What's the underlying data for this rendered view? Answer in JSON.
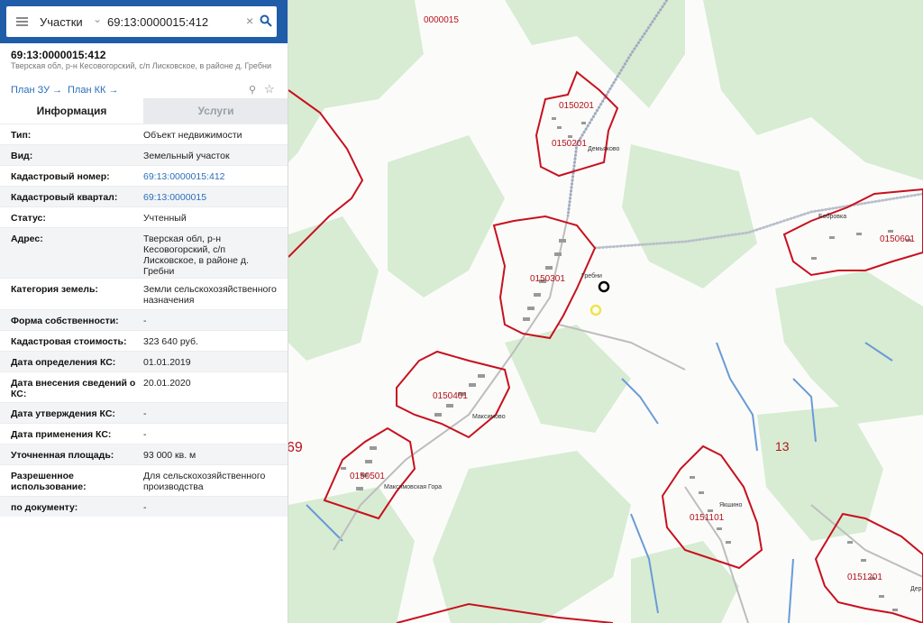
{
  "search": {
    "type_label": "Участки",
    "query": "69:13:0000015:412"
  },
  "object": {
    "title": "69:13:0000015:412",
    "address_short": "Тверская обл, р-н Кесовогорский, с/п Лисковское, в районе д. Гребни"
  },
  "links": {
    "plan_zu": "План ЗУ",
    "plan_kk": "План КК"
  },
  "tabs": {
    "info": "Информация",
    "services": "Услуги"
  },
  "info_rows": [
    {
      "label": "Тип:",
      "value": "Объект недвижимости"
    },
    {
      "label": "Вид:",
      "value": "Земельный участок"
    },
    {
      "label": "Кадастровый номер:",
      "value": "69:13:0000015:412",
      "link": true
    },
    {
      "label": "Кадастровый квартал:",
      "value": "69:13:0000015",
      "link": true
    },
    {
      "label": "Статус:",
      "value": "Учтенный"
    },
    {
      "label": "Адрес:",
      "value": "Тверская обл, р-н Кесовогорский, с/п Лисковское, в районе д. Гребни"
    },
    {
      "label": "Категория земель:",
      "value": "Земли сельскохозяйственного назначения"
    },
    {
      "label": "Форма собственности:",
      "value": "-"
    },
    {
      "label": "Кадастровая стоимость:",
      "value": "323 640 руб."
    },
    {
      "label": "Дата определения КС:",
      "value": "01.01.2019"
    },
    {
      "label": "Дата внесения сведений о КС:",
      "value": "20.01.2020"
    },
    {
      "label": "Дата утверждения КС:",
      "value": "-"
    },
    {
      "label": "Дата применения КС:",
      "value": "-"
    },
    {
      "label": "Уточненная площадь:",
      "value": "93 000 кв. м"
    },
    {
      "label": "Разрешенное использование:",
      "value": "Для сельскохозяйственного производства"
    },
    {
      "label": "по документу:",
      "value": "-"
    }
  ],
  "map": {
    "labels": [
      {
        "id": "q-0000015",
        "text": "0000015"
      },
      {
        "id": "q-0150201a",
        "text": "0150201"
      },
      {
        "id": "q-0150201b",
        "text": "0150201"
      },
      {
        "id": "q-0150301",
        "text": "0150301"
      },
      {
        "id": "q-0150401",
        "text": "0150401"
      },
      {
        "id": "q-0150501",
        "text": "0150501"
      },
      {
        "id": "q-0150601",
        "text": "0150601"
      },
      {
        "id": "q-0151101",
        "text": "0151101"
      },
      {
        "id": "q-0151201",
        "text": "0151201"
      },
      {
        "id": "district-13",
        "text": "13"
      },
      {
        "id": "district-69",
        "text": "69"
      }
    ],
    "places": [
      {
        "id": "village-demyakovo",
        "text": "Демьяково"
      },
      {
        "id": "village-grebni",
        "text": "Гребни"
      },
      {
        "id": "village-bobrovka",
        "text": "Бобровка"
      },
      {
        "id": "village-maksimovo",
        "text": "Максимово"
      },
      {
        "id": "village-maksimovskaya-gora",
        "text": "Максимовская Гора"
      },
      {
        "id": "village-yakshino",
        "text": "Якшино"
      },
      {
        "id": "village-der",
        "text": "Дер"
      }
    ],
    "colors": {
      "boundary": "#c8101e",
      "forest": "#d6ecd2",
      "water": "#5a8fd0",
      "road": "#b9b9b9",
      "marker_selected": "#000000",
      "marker_secondary": "#f0e44a"
    }
  }
}
